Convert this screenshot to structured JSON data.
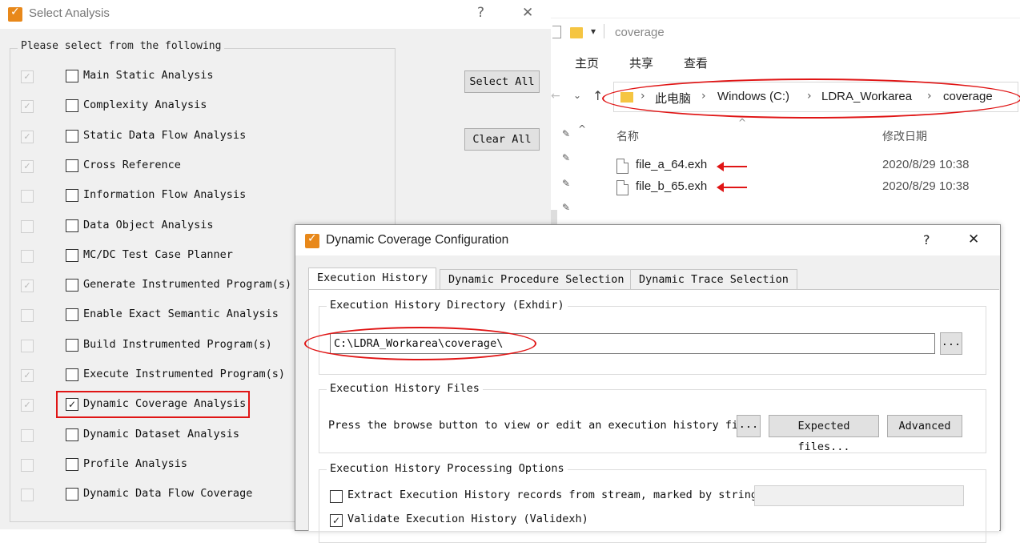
{
  "explorer": {
    "path_title": "coverage",
    "ribbon_tabs": [
      "主页",
      "共享",
      "查看"
    ],
    "breadcrumbs": [
      "此电脑",
      "Windows (C:)",
      "LDRA_Workarea",
      "coverage"
    ],
    "columns": {
      "name": "名称",
      "date": "修改日期"
    },
    "files": [
      {
        "name": "file_a_64.exh",
        "date": "2020/8/29 10:38"
      },
      {
        "name": "file_b_65.exh",
        "date": "2020/8/29 10:38"
      }
    ]
  },
  "select_analysis": {
    "title": "Select Analysis",
    "help": "?",
    "close": "✕",
    "group_label": "Please select from the following",
    "select_all": "Select All",
    "clear_all": "Clear All",
    "items": [
      {
        "label": "Main Static Analysis",
        "status": "✓",
        "checked": ""
      },
      {
        "label": "Complexity Analysis",
        "status": "✓",
        "checked": ""
      },
      {
        "label": "Static Data Flow Analysis",
        "status": "✓",
        "checked": ""
      },
      {
        "label": "Cross Reference",
        "status": "✓",
        "checked": ""
      },
      {
        "label": "Information Flow Analysis",
        "status": "",
        "checked": ""
      },
      {
        "label": "Data Object Analysis",
        "status": "",
        "checked": ""
      },
      {
        "label": "MC/DC Test Case Planner",
        "status": "",
        "checked": ""
      },
      {
        "label": "Generate Instrumented Program(s)",
        "status": "✓",
        "checked": ""
      },
      {
        "label": "Enable Exact Semantic Analysis",
        "status": "",
        "checked": ""
      },
      {
        "label": "Build Instrumented Program(s)",
        "status": "",
        "checked": ""
      },
      {
        "label": "Execute Instrumented Program(s)",
        "status": "✓",
        "checked": ""
      },
      {
        "label": "Dynamic Coverage Analysis",
        "status": "✓",
        "checked": "✓"
      },
      {
        "label": "Dynamic Dataset Analysis",
        "status": "",
        "checked": ""
      },
      {
        "label": "Profile Analysis",
        "status": "",
        "checked": ""
      },
      {
        "label": "Dynamic Data Flow Coverage",
        "status": "",
        "checked": ""
      }
    ]
  },
  "dynamic_coverage": {
    "title": "Dynamic Coverage Configuration",
    "help": "?",
    "close": "✕",
    "tabs": [
      "Execution History",
      "Dynamic Procedure Selection",
      "Dynamic Trace Selection"
    ],
    "dir_group": "Execution History Directory (Exhdir)",
    "dir_value": "C:\\LDRA_Workarea\\coverage\\",
    "browse": "...",
    "files_group": "Execution History Files",
    "files_text": "Press the browse button to view or edit an execution history file",
    "expected_files": "Expected files...",
    "advanced": "Advanced",
    "options_group": "Execution History Processing Options",
    "opt_extract": "Extract Execution History records from stream, marked by string:",
    "opt_validate": "Validate Execution History (Validexh)",
    "opt_validate_checked": "✓"
  }
}
